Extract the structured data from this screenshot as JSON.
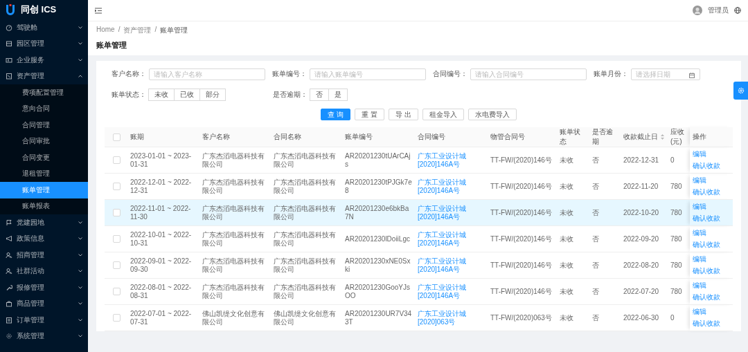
{
  "sidebar": {
    "logo_text": "同创 ICS",
    "items": [
      {
        "label": "驾驶舱",
        "expanded": false
      },
      {
        "label": "园区管理",
        "expanded": false
      },
      {
        "label": "企业服务",
        "expanded": false
      },
      {
        "label": "资产管理",
        "expanded": true,
        "children": [
          {
            "label": "费项配置管理",
            "selected": false
          },
          {
            "label": "意向合同",
            "selected": false
          },
          {
            "label": "合同管理",
            "selected": false
          },
          {
            "label": "合同审批",
            "selected": false
          },
          {
            "label": "合同变更",
            "selected": false
          },
          {
            "label": "退租管理",
            "selected": false
          },
          {
            "label": "账单管理",
            "selected": true
          },
          {
            "label": "账单报表",
            "selected": false
          }
        ]
      },
      {
        "label": "党建园地",
        "expanded": false
      },
      {
        "label": "政策信息",
        "expanded": false
      },
      {
        "label": "招商管理",
        "expanded": false
      },
      {
        "label": "社群活动",
        "expanded": false
      },
      {
        "label": "报修管理",
        "expanded": false
      },
      {
        "label": "商品管理",
        "expanded": false
      },
      {
        "label": "订单管理",
        "expanded": false
      },
      {
        "label": "系统管理",
        "expanded": false
      }
    ]
  },
  "header": {
    "user_name": "管理员"
  },
  "breadcrumb": [
    {
      "label": "Home"
    },
    {
      "separator": "/",
      "label": "资产管理"
    },
    {
      "separator": "/",
      "label": "账单管理"
    }
  ],
  "page_title": "账单管理",
  "filters": {
    "fields": [
      {
        "kind": "text",
        "label": "客户名称：",
        "placeholder": "请输入客户名称"
      },
      {
        "kind": "text",
        "label": "账单编号：",
        "placeholder": "请输入账单编号"
      },
      {
        "kind": "text",
        "label": "合同编号：",
        "placeholder": "请输入合同编号"
      },
      {
        "kind": "date",
        "label": "账单月份：",
        "placeholder": "请选择日期"
      }
    ],
    "toggles": [
      {
        "label": "账单状态：",
        "options": [
          {
            "label": "未收",
            "selected": false
          },
          {
            "label": "已收",
            "selected": false
          },
          {
            "label": "部分",
            "selected": false
          }
        ]
      },
      {
        "label": "是否逾期：",
        "options": [
          {
            "label": "否",
            "selected": false
          },
          {
            "label": "是",
            "selected": false
          }
        ]
      }
    ],
    "buttons": [
      {
        "label": "查 询",
        "kind": "primary"
      },
      {
        "label": "重 置",
        "kind": "default"
      },
      {
        "label": "导 出",
        "kind": "default"
      },
      {
        "label": "租金导入",
        "kind": "default"
      },
      {
        "label": "水电费导入",
        "kind": "default"
      }
    ]
  },
  "table": {
    "all_checked": false,
    "columns": [
      {
        "label": "账期",
        "sortable": false
      },
      {
        "label": "客户名称",
        "sortable": false
      },
      {
        "label": "合同名称",
        "sortable": false
      },
      {
        "label": "账单编号",
        "sortable": false
      },
      {
        "label": "合同编号",
        "sortable": false
      },
      {
        "label": "物管合同号",
        "sortable": false
      },
      {
        "label": "账单状态",
        "sortable": false
      },
      {
        "label": "是否逾期",
        "sortable": false
      },
      {
        "label": "收款截止日",
        "sortable": true
      },
      {
        "label": "应收(元)",
        "sortable": false
      },
      {
        "label": "操作",
        "sortable": false
      }
    ],
    "rows": [
      {
        "checked": false,
        "hovered": false,
        "period": "2023-01-01 ~ 2023-01-31",
        "customer": "广东杰滔电器科技有限公司",
        "contract_name": "广东杰滔电器科技有限公司",
        "bill_no": "AR20201230tUArCAjs",
        "contract_no": "广东工业设计城[2020]146A号",
        "property_contract_no": "TT-FW/(2020)146号",
        "status": "未收",
        "overdue": "否",
        "due_date": "2022-12-31",
        "receivable": "0",
        "actions": [
          "编辑",
          "确认收款"
        ]
      },
      {
        "checked": false,
        "hovered": false,
        "period": "2022-12-01 ~ 2022-12-31",
        "customer": "广东杰滔电器科技有限公司",
        "contract_name": "广东杰滔电器科技有限公司",
        "bill_no": "AR20201230tPJGk7e8",
        "contract_no": "广东工业设计城[2020]146A号",
        "property_contract_no": "TT-FW/(2020)146号",
        "status": "未收",
        "overdue": "否",
        "due_date": "2022-11-20",
        "receivable": "780",
        "actions": [
          "编辑",
          "确认收款"
        ]
      },
      {
        "checked": false,
        "hovered": true,
        "period": "2022-11-01 ~ 2022-11-30",
        "customer": "广东杰滔电器科技有限公司",
        "contract_name": "广东杰滔电器科技有限公司",
        "bill_no": "AR20201230e6bkBa7N",
        "contract_no": "广东工业设计城[2020]146A号",
        "property_contract_no": "TT-FW/(2020)146号",
        "status": "未收",
        "overdue": "否",
        "due_date": "2022-10-20",
        "receivable": "780",
        "actions": [
          "编辑",
          "确认收款"
        ]
      },
      {
        "checked": false,
        "hovered": false,
        "period": "2022-10-01 ~ 2022-10-31",
        "customer": "广东杰滔电器科技有限公司",
        "contract_name": "广东杰滔电器科技有限公司",
        "bill_no": "AR20201230lDoiiLgc",
        "contract_no": "广东工业设计城[2020]146A号",
        "property_contract_no": "TT-FW/(2020)146号",
        "status": "未收",
        "overdue": "否",
        "due_date": "2022-09-20",
        "receivable": "780",
        "actions": [
          "编辑",
          "确认收款"
        ]
      },
      {
        "checked": false,
        "hovered": false,
        "period": "2022-09-01 ~ 2022-09-30",
        "customer": "广东杰滔电器科技有限公司",
        "contract_name": "广东杰滔电器科技有限公司",
        "bill_no": "AR20201230xNE0Sxki",
        "contract_no": "广东工业设计城[2020]146A号",
        "property_contract_no": "TT-FW/(2020)146号",
        "status": "未收",
        "overdue": "否",
        "due_date": "2022-08-20",
        "receivable": "780",
        "actions": [
          "编辑",
          "确认收款"
        ]
      },
      {
        "checked": false,
        "hovered": false,
        "period": "2022-08-01 ~ 2022-08-31",
        "customer": "广东杰滔电器科技有限公司",
        "contract_name": "广东杰滔电器科技有限公司",
        "bill_no": "AR20201230GooYJsOO",
        "contract_no": "广东工业设计城[2020]146A号",
        "property_contract_no": "TT-FW/(2020)146号",
        "status": "未收",
        "overdue": "否",
        "due_date": "2022-07-20",
        "receivable": "780",
        "actions": [
          "编辑",
          "确认收款"
        ]
      },
      {
        "checked": false,
        "hovered": false,
        "period": "2022-07-01 ~ 2022-07-31",
        "customer": "佛山凯缇文化创意有限公司",
        "contract_name": "佛山凯缇文化创意有限公司",
        "bill_no": "AR20201230UR7V343T",
        "contract_no": "广东工业设计城[2020]063号",
        "property_contract_no": "TT-FW/(2020)063号",
        "status": "未收",
        "overdue": "否",
        "due_date": "2022-06-30",
        "receivable": "0",
        "actions": [
          "编辑",
          "确认收款"
        ]
      }
    ]
  }
}
